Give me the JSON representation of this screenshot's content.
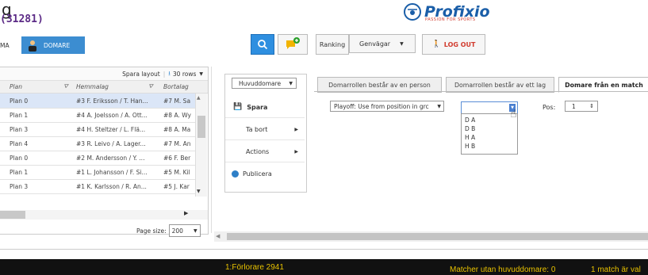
{
  "header": {
    "title_partial": "g",
    "id_text": "(31281)",
    "logo": {
      "word": "Profixio",
      "tagline": "PASSION FOR SPORTS"
    }
  },
  "nav": {
    "left_tab_partial": "MA",
    "domare_tab": "DOMARE",
    "search_icon": "search-icon",
    "notify_icon": "chat-plus-icon",
    "ranking": "Ranking",
    "genvagar": "Genvägar",
    "logout": "LOG OUT"
  },
  "grid": {
    "toolbar": {
      "save_layout": "Spara layout",
      "rows": "30 rows"
    },
    "columns": [
      "Plan",
      "Hemmalag",
      "Bortalag"
    ],
    "rows": [
      [
        "Plan 0",
        "#3 F. Eriksson / T. Han...",
        "#7 M. Sa"
      ],
      [
        "Plan 1",
        "#4 A. Joelsson / A. Ott...",
        "#8 A. Wy"
      ],
      [
        "Plan 3",
        "#4 H. Steltzer / L. Flä...",
        "#8 A. Ma"
      ],
      [
        "Plan 4",
        "#3 R. Leivo / A. Lager...",
        "#7 M. An"
      ],
      [
        "Plan 0",
        "#2 M. Andersson / Y. ...",
        "#6 F. Ber"
      ],
      [
        "Plan 1",
        "#1 L. Johansson / F. Si...",
        "#5 M. Kil"
      ],
      [
        "Plan 3",
        "#1 K. Karlsson / R. An...",
        "#5 J. Kar"
      ]
    ],
    "page_size_label": "Page size:",
    "page_size_value": "200"
  },
  "menu": {
    "dropdown": "Huvuddomare",
    "spara": "Spara",
    "ta_bort": "Ta bort",
    "actions": "Actions",
    "publicera": "Publicera"
  },
  "tabs": [
    "Domarrollen består av en person",
    "Domarrollen består av ett lag",
    "Domare från en match"
  ],
  "form": {
    "playoff_select": "Playoff: Use from position in grc",
    "open_select_value": "",
    "options": [
      "D A",
      "D B",
      "H A",
      "H B"
    ],
    "pos_label": "Pos:",
    "pos_value": "1"
  },
  "status": {
    "loser": "1:Förlorare 2941",
    "matches_no_ref": "Matcher utan huvuddomare: 0",
    "match_is": "1 match är val"
  },
  "colors": {
    "accent": "#3c8dd1",
    "status_text": "#e8c200",
    "brand": "#1a5ea8",
    "logout": "#d13b2e"
  }
}
